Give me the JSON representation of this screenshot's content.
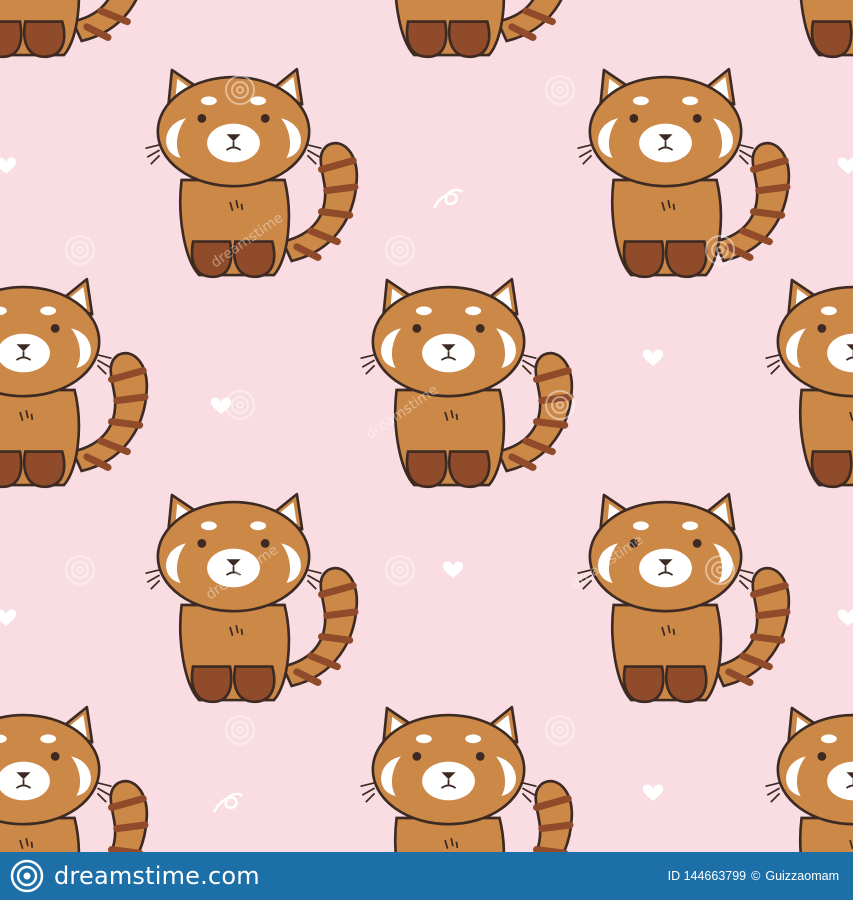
{
  "image": {
    "subject": "red-panda",
    "background_color": "#f9dde2",
    "fur_color": "#cc8847",
    "dark_fur_color": "#8f4b2a",
    "outline_color": "#3d2a23",
    "accent_color": "#ffffff"
  },
  "watermark": {
    "overlay_text": "dreamstime"
  },
  "footer": {
    "background_color": "#1d6fa8",
    "brand_text": "dreamstime.com",
    "id_text": "ID 144663799",
    "separator": "©",
    "author_text": "Guizzaomam"
  }
}
